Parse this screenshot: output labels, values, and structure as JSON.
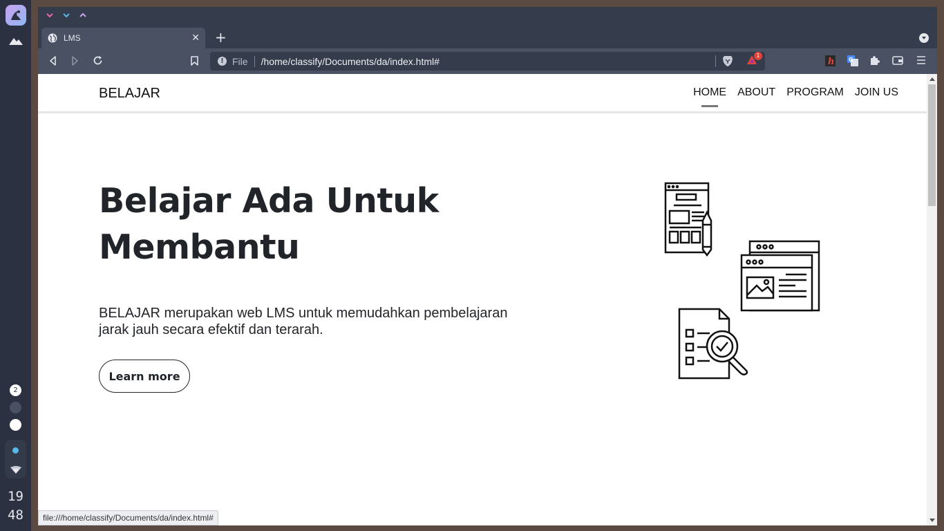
{
  "dock": {
    "workspace_number": "2",
    "clock_hours": "19",
    "clock_minutes": "48"
  },
  "browser": {
    "tab_title": "LMS",
    "url_scheme_label": "File",
    "url": "/home/classify/Documents/da/index.html#",
    "rewards_badge": "1",
    "status_url": "file:///home/classify/Documents/da/index.html#"
  },
  "site": {
    "brand": "BELAJAR",
    "nav": [
      {
        "label": "HOME",
        "active": true
      },
      {
        "label": "ABOUT",
        "active": false
      },
      {
        "label": "PROGRAM",
        "active": false
      },
      {
        "label": "JOIN US",
        "active": false
      }
    ],
    "hero": {
      "title": "Belajar Ada Untuk Membantu",
      "description": "BELAJAR merupakan web LMS untuk memudahkan pembelajaran jarak jauh secara efektif dan terarah.",
      "button_label": "Learn more"
    }
  },
  "colors": {
    "dock_bg": "#2b3140",
    "browser_chrome": "#353c4c",
    "toolbar": "#4a5163",
    "accent_pink": "#e86aa0",
    "accent_blue": "#5ab8e8",
    "accent_purple": "#c9a3f0",
    "text_dark": "#212529"
  }
}
